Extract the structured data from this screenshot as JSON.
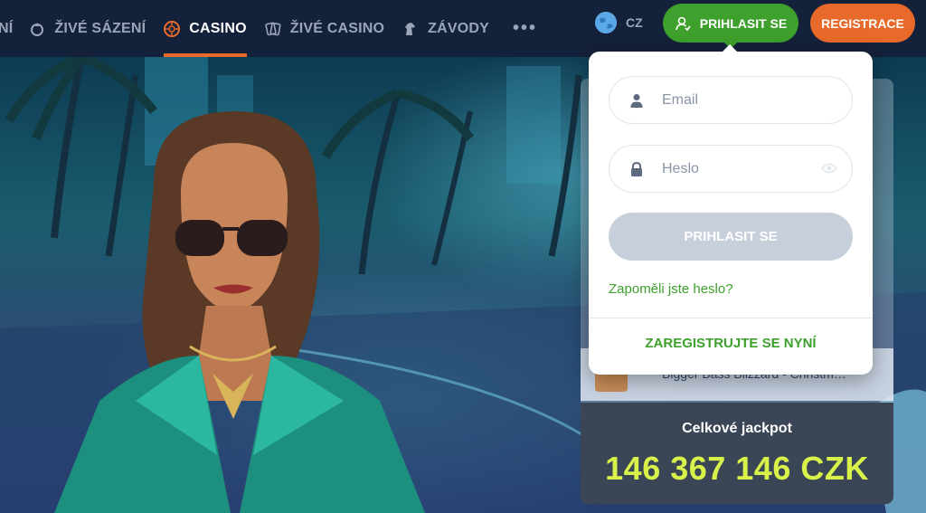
{
  "nav": {
    "partial_item": "NÍ",
    "items": [
      {
        "label": "ŽIVÉ SÁZENÍ",
        "icon": "live-betting-icon",
        "active": false
      },
      {
        "label": "CASINO",
        "icon": "roulette-icon",
        "active": true
      },
      {
        "label": "ŽIVÉ CASINO",
        "icon": "cards-icon",
        "active": false
      },
      {
        "label": "ZÁVODY",
        "icon": "horse-icon",
        "active": false
      }
    ],
    "more": "•••"
  },
  "header": {
    "lang_code": "CZ",
    "login_label": "PRIHLASIT SE",
    "register_label": "REGISTRACE"
  },
  "login_form": {
    "email_placeholder": "Email",
    "password_placeholder": "Heslo",
    "submit_label": "PRIHLASIT SE",
    "forgot_label": "Zapoměli jste heslo?",
    "register_now_label": "ZAREGISTRUJTE SE NYNÍ"
  },
  "side_panel": {
    "partial_game": "Bigger Bass Blizzard - Christm…"
  },
  "jackpot": {
    "label": "Celkové jackpot",
    "value": "146 367 146 CZK"
  },
  "colors": {
    "accent_green": "#3ea02d",
    "accent_orange": "#e86a2a",
    "topbar_bg": "#14213a",
    "jackpot_value": "#d8f24a"
  }
}
